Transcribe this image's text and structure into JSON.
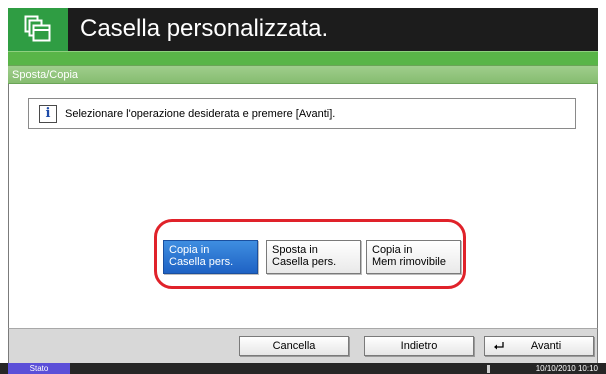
{
  "header": {
    "title": "Casella personalizzata.",
    "icon": "custom-box-icon"
  },
  "section": {
    "title": "Sposta/Copia"
  },
  "message": {
    "icon": "info-icon",
    "text": "Selezionare l'operazione desiderata e premere [Avanti]."
  },
  "options": [
    {
      "line1": "Copia in",
      "line2": "Casella pers.",
      "selected": true
    },
    {
      "line1": "Sposta in",
      "line2": "Casella pers.",
      "selected": false
    },
    {
      "line1": "Copia in",
      "line2": "Mem rimovibile",
      "selected": false
    }
  ],
  "buttons": {
    "cancel": "Cancella",
    "back": "Indietro",
    "next": "Avanti"
  },
  "status": {
    "tab": "Stato",
    "datetime": "10/10/2010  10:10"
  },
  "colors": {
    "title_bar": "#1c1c1c",
    "accent_green": "#2f9d43",
    "selected_blue": "#1f62c4",
    "highlight_red": "#e0222a",
    "status_tab": "#5b4fd8"
  }
}
